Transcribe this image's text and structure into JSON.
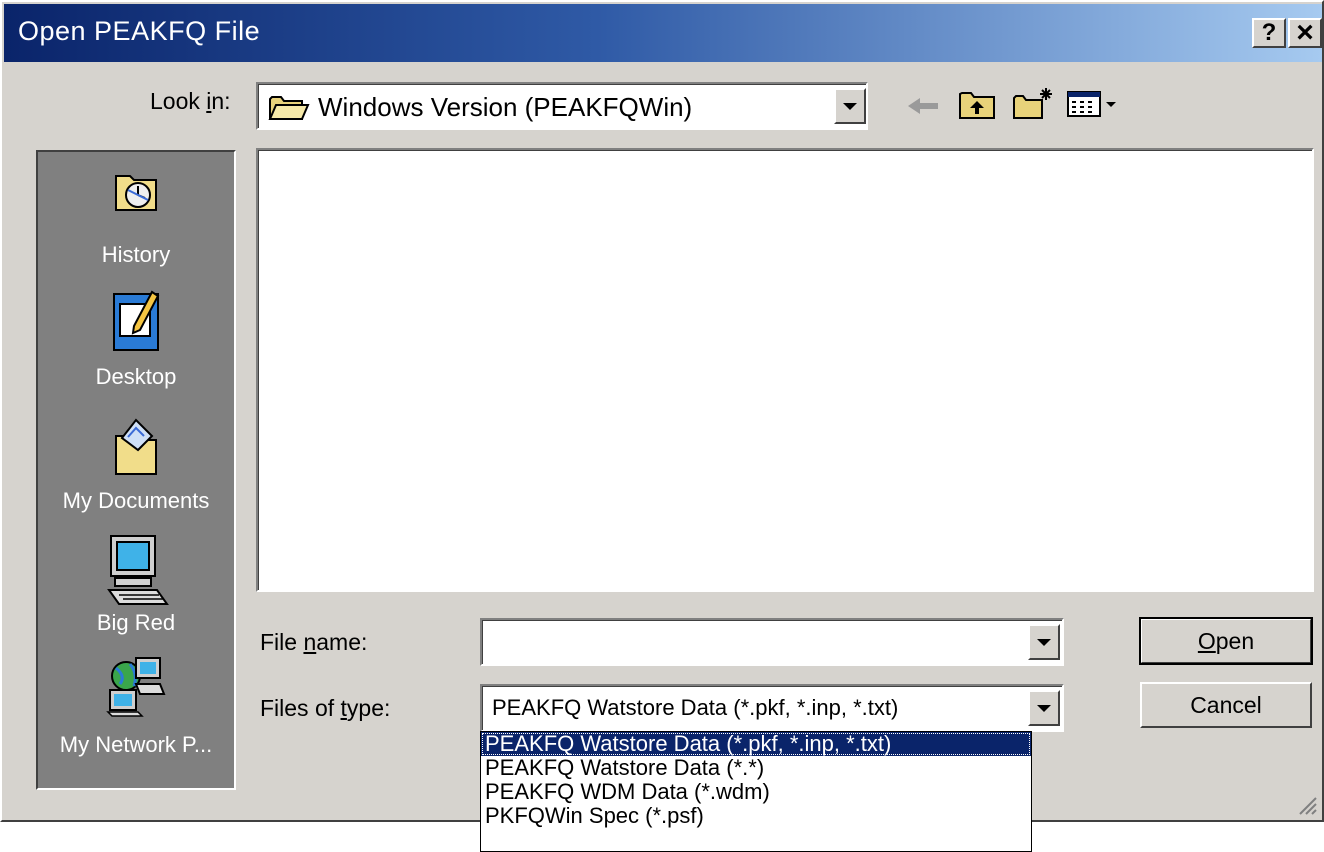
{
  "window": {
    "title": "Open PEAKFQ File",
    "help_label": "?",
    "close_label": "×"
  },
  "look_in": {
    "label_pre": "Look ",
    "label_accel": "i",
    "label_post": "n:",
    "value": "Windows Version (PEAKFQWin)"
  },
  "toolbar": {
    "icons": [
      "back-icon",
      "up-folder-icon",
      "new-folder-icon",
      "view-menu-icon"
    ]
  },
  "places": [
    {
      "label": "History",
      "icon": "history-icon"
    },
    {
      "label": "Desktop",
      "icon": "desktop-icon"
    },
    {
      "label": "My Documents",
      "icon": "my-documents-icon"
    },
    {
      "label": "Big Red",
      "icon": "computer-icon"
    },
    {
      "label": "My Network P...",
      "icon": "network-icon"
    }
  ],
  "file_name": {
    "label_pre": "File ",
    "label_accel": "n",
    "label_post": "ame:",
    "value": ""
  },
  "file_type": {
    "label_pre": "Files of ",
    "label_accel": "t",
    "label_post": "ype:",
    "value": "PEAKFQ Watstore Data (*.pkf, *.inp, *.txt)",
    "options": [
      "PEAKFQ Watstore Data (*.pkf, *.inp, *.txt)",
      "PEAKFQ Watstore Data (*.*)",
      "PEAKFQ WDM Data (*.wdm)",
      "PKFQWin Spec (*.psf)"
    ],
    "selected_index": 0
  },
  "buttons": {
    "open_accel": "O",
    "open_rest": "pen",
    "cancel": "Cancel"
  },
  "colors": {
    "title_start": "#0a246a",
    "title_end": "#a6caf0",
    "face": "#d6d3ce",
    "places_bg": "#808080",
    "highlight": "#0a246a"
  }
}
